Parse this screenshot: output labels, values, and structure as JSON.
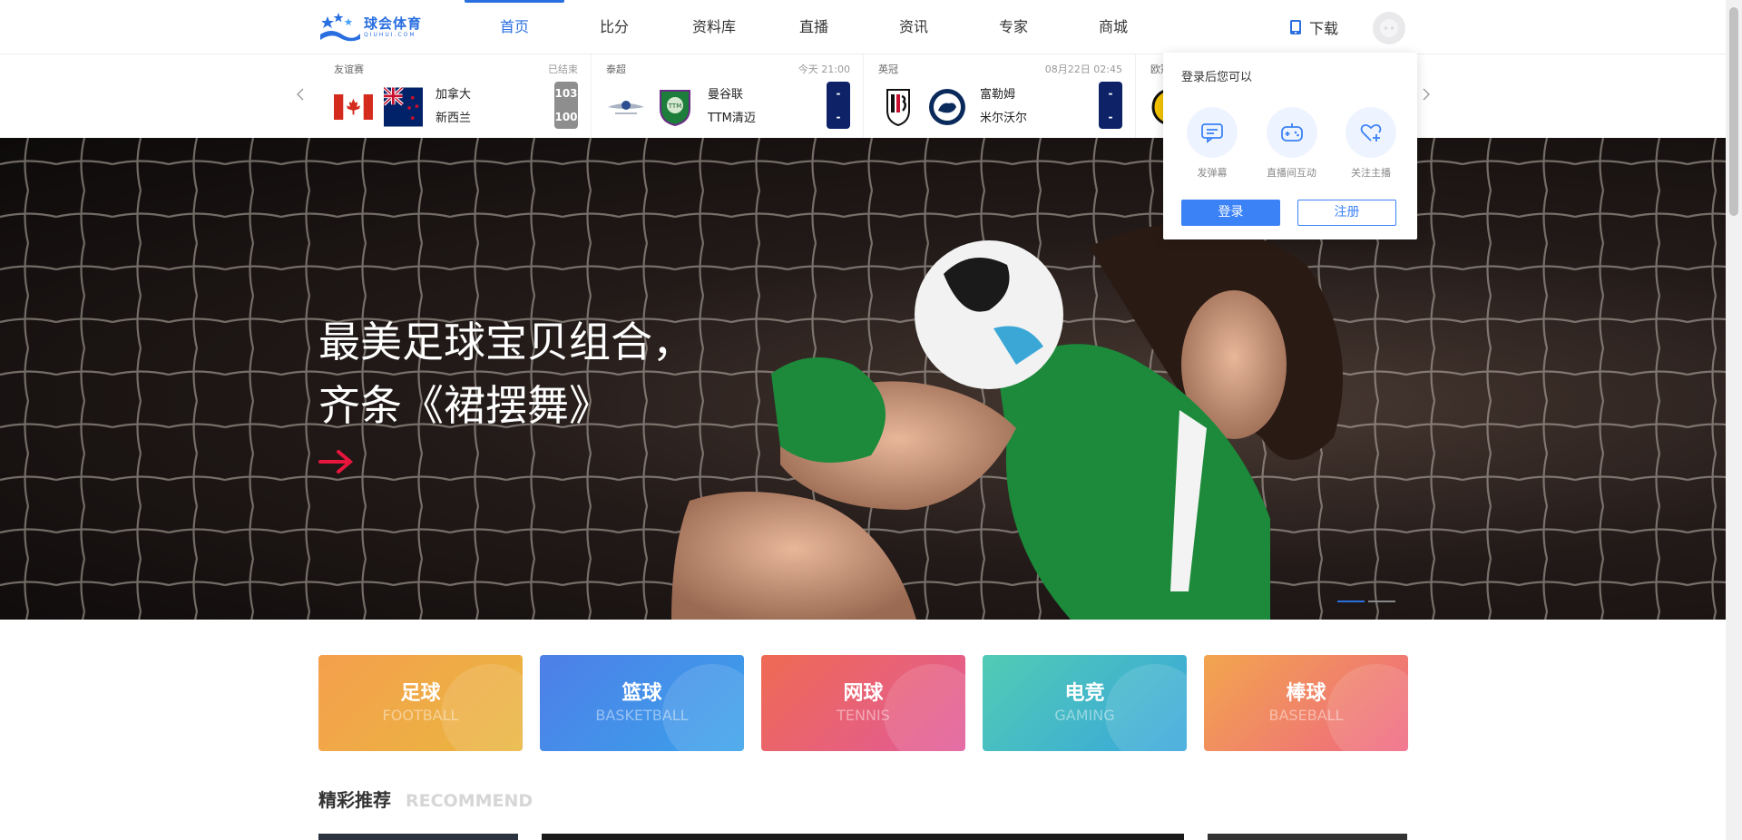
{
  "header": {
    "logo_cn": "球会体育",
    "logo_en": "QIUHUI.COM",
    "nav": [
      {
        "label": "首页",
        "active": true
      },
      {
        "label": "比分"
      },
      {
        "label": "资料库"
      },
      {
        "label": "直播"
      },
      {
        "label": "资讯"
      },
      {
        "label": "专家"
      },
      {
        "label": "商城"
      }
    ],
    "download_label": "下载"
  },
  "ticker": {
    "matches": [
      {
        "league": "友谊赛",
        "status": "已结束",
        "home": "加拿大",
        "away": "新西兰",
        "home_score": "103",
        "away_score": "100",
        "finished": true
      },
      {
        "league": "泰超",
        "status": "今天 21:00",
        "home": "曼谷联",
        "away": "TTM清迈",
        "home_score": "-",
        "away_score": "-",
        "finished": false
      },
      {
        "league": "英冠",
        "status": "08月22日 02:45",
        "home": "富勒姆",
        "away": "米尔沃尔",
        "home_score": "-",
        "away_score": "-",
        "finished": false
      },
      {
        "league": "欧冠",
        "status": "",
        "home": "",
        "away": "",
        "home_score": "",
        "away_score": "",
        "finished": false
      }
    ]
  },
  "banner": {
    "title_line1": "最美足球宝贝组合，",
    "title_line2": "齐条《裙摆舞》",
    "active_slide": 1,
    "slide_count": 2
  },
  "sports": [
    {
      "cn": "足球",
      "en": "FOOTBALL",
      "color_from": "#f5a04d",
      "color_to": "#e9b63f"
    },
    {
      "cn": "篮球",
      "en": "BASKETBALL",
      "color_from": "#4e7fe8",
      "color_to": "#3aa2ea"
    },
    {
      "cn": "网球",
      "en": "TENNIS",
      "color_from": "#ef6a53",
      "color_to": "#e15a9a"
    },
    {
      "cn": "电竞",
      "en": "GAMING",
      "color_from": "#52cbb4",
      "color_to": "#38a6dc"
    },
    {
      "cn": "棒球",
      "en": "BASEBALL",
      "color_from": "#f2a54d",
      "color_to": "#ef6683"
    }
  ],
  "recommend": {
    "title_cn": "精彩推荐",
    "title_en": "RECOMMEND"
  },
  "login_popup": {
    "title": "登录后您可以",
    "features": [
      {
        "label": "发弹幕",
        "icon": "chat-icon"
      },
      {
        "label": "直播间互动",
        "icon": "gamepad-icon"
      },
      {
        "label": "关注主播",
        "icon": "heart-plus-icon"
      }
    ],
    "login_label": "登录",
    "register_label": "注册"
  },
  "colors": {
    "accent": "#2a6fe0",
    "button": "#3b82f6",
    "score_bg": "#0e2367",
    "score_finished_bg": "#8e8e8e"
  }
}
